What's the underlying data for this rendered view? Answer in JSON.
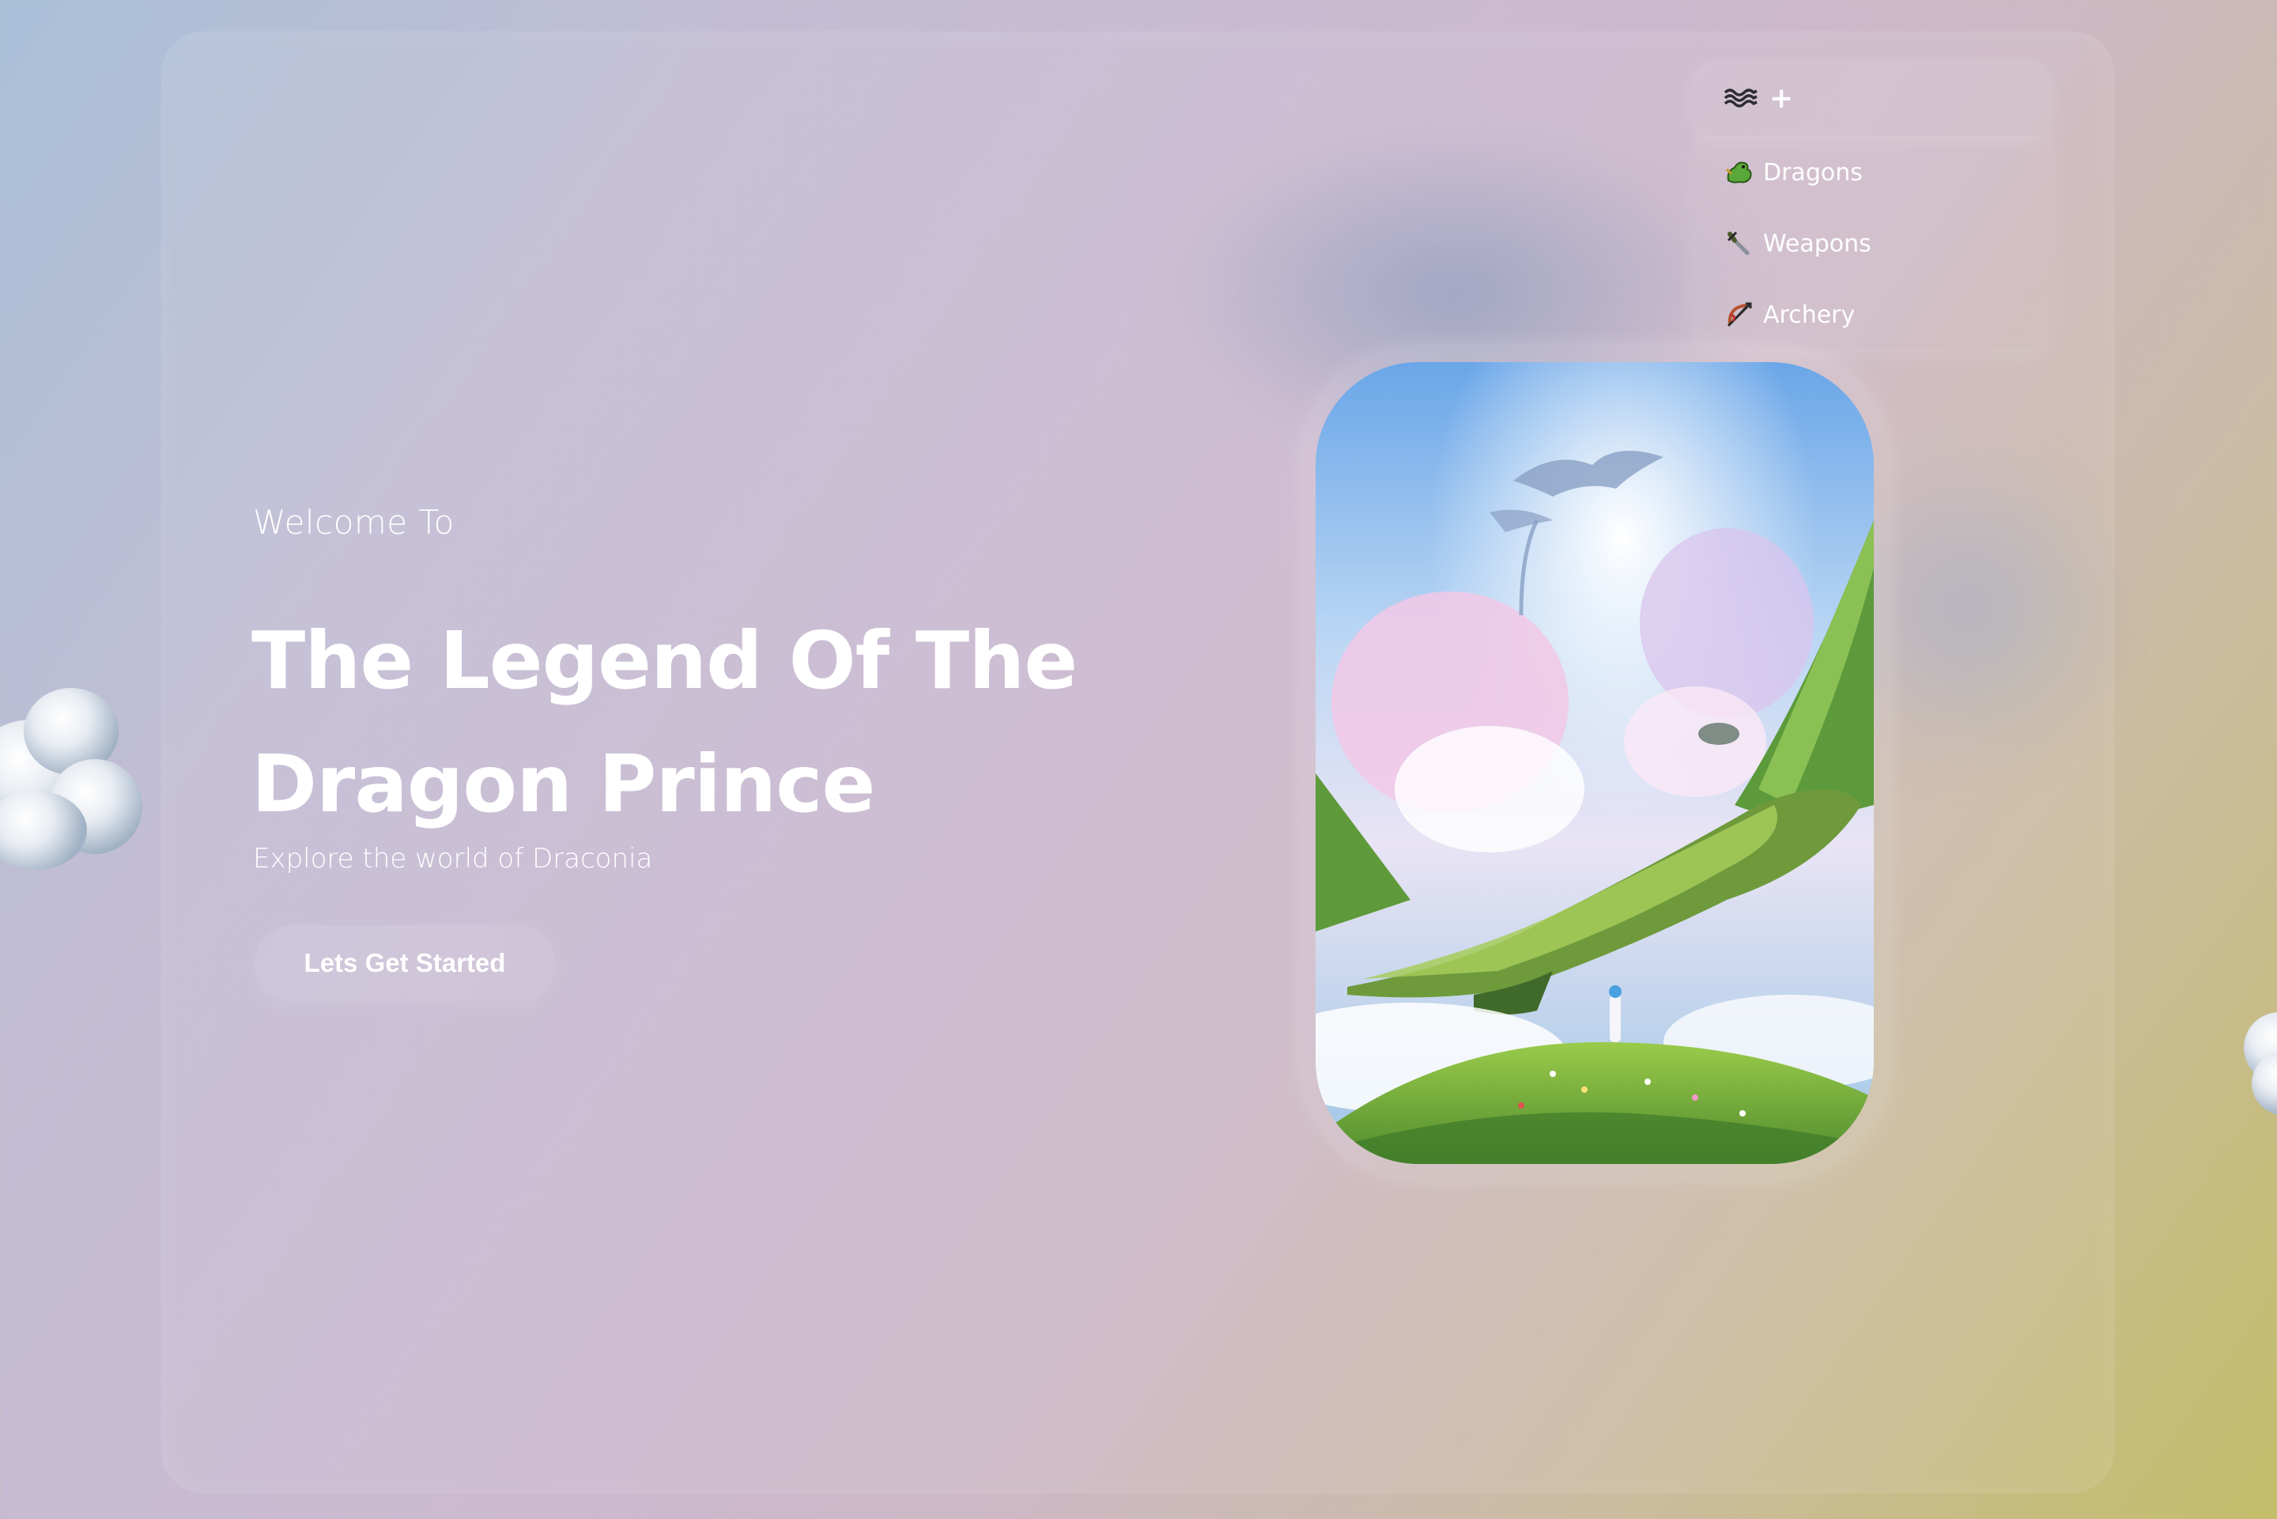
{
  "hero": {
    "welcome": "Welcome To",
    "title_line1": "The Legend Of The",
    "title_line2": "Dragon Prince",
    "subtitle": "Explore the world of Draconia",
    "cta_label": "Lets Get Started"
  },
  "menu": {
    "toggle_icon": "wave-icon",
    "toggle_symbol": "+",
    "items": [
      {
        "label": "Dragons",
        "icon": "dragon-icon"
      },
      {
        "label": "Weapons",
        "icon": "dagger-icon"
      },
      {
        "label": "Archery",
        "icon": "bow-arrow-icon"
      }
    ]
  },
  "card": {
    "image": "dragon-sky-landscape-illustration"
  },
  "colors": {
    "bg_top_left": "#a9c0d8",
    "bg_mid": "#ccb9cf",
    "bg_bottom_right": "#c3bd6a",
    "text": "#ffffff"
  }
}
